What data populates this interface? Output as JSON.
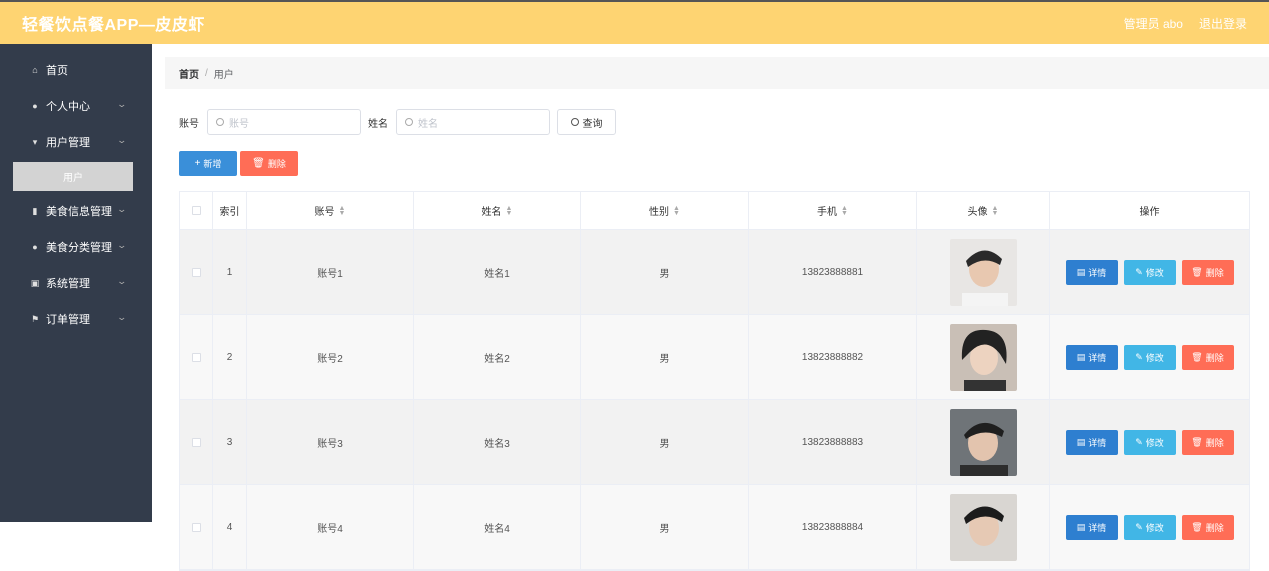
{
  "header": {
    "title": "轻餐饮点餐APP—皮皮虾",
    "admin": "管理员 abo",
    "logout": "退出登录"
  },
  "sidebar": {
    "items": [
      {
        "label": "首页",
        "icon": "home-icon",
        "glyph": "⌂"
      },
      {
        "label": "个人中心",
        "icon": "user-icon",
        "glyph": "●"
      },
      {
        "label": "用户管理",
        "icon": "user-manage-icon",
        "glyph": "▾"
      },
      {
        "label": "美食信息管理",
        "icon": "food-info-icon",
        "glyph": "▮"
      },
      {
        "label": "美食分类管理",
        "icon": "food-category-icon",
        "glyph": "●"
      },
      {
        "label": "系统管理",
        "icon": "system-icon",
        "glyph": "▣"
      },
      {
        "label": "订单管理",
        "icon": "flag-icon",
        "glyph": "⚑"
      }
    ],
    "submenu_active": "用户"
  },
  "breadcrumb": {
    "home": "首页",
    "current": "用户"
  },
  "search": {
    "account_label": "账号",
    "account_placeholder": "账号",
    "name_label": "姓名",
    "name_placeholder": "姓名",
    "query": "查询"
  },
  "actions": {
    "add": "新增",
    "delete": "删除"
  },
  "table": {
    "headers": [
      "索引",
      "账号",
      "姓名",
      "性别",
      "手机",
      "头像",
      "操作"
    ],
    "rows": [
      {
        "index": "1",
        "account": "账号1",
        "name": "姓名1",
        "gender": "男",
        "phone": "13823888881"
      },
      {
        "index": "2",
        "account": "账号2",
        "name": "姓名2",
        "gender": "男",
        "phone": "13823888882"
      },
      {
        "index": "3",
        "account": "账号3",
        "name": "姓名3",
        "gender": "男",
        "phone": "13823888883"
      },
      {
        "index": "4",
        "account": "账号4",
        "name": "姓名4",
        "gender": "男",
        "phone": "13823888884"
      }
    ],
    "ops": {
      "detail": "详情",
      "edit": "修改",
      "delete": "删除"
    }
  },
  "colors": {
    "header": "#fed472",
    "sidebar": "#333c4b",
    "primary": "#3a8fd9",
    "danger": "#ff6d56",
    "info": "#41b6e6"
  }
}
